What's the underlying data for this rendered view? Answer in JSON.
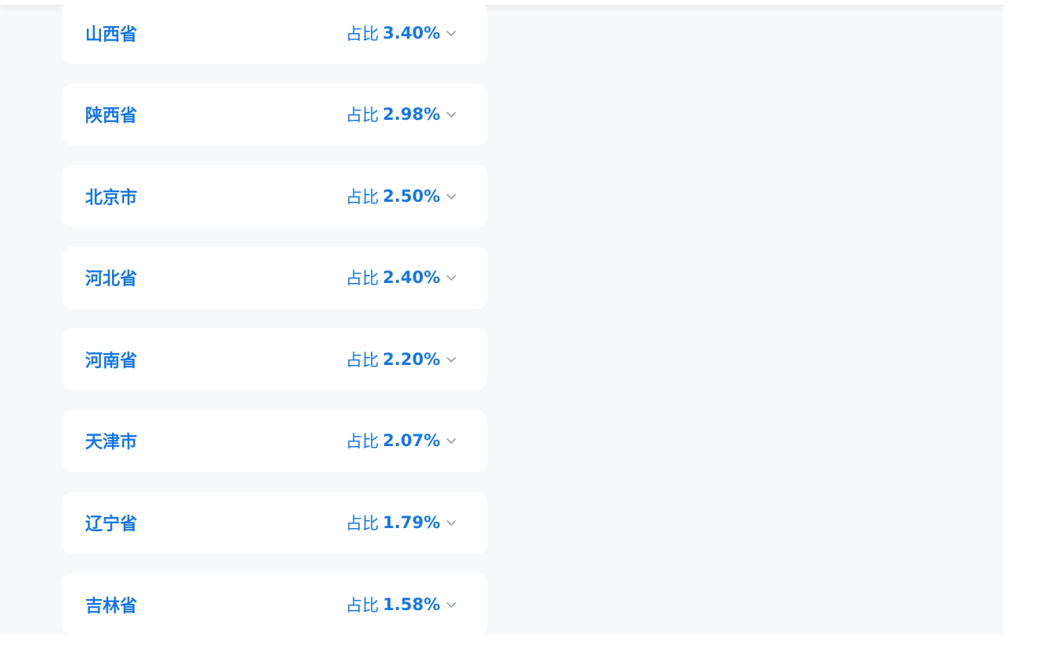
{
  "regions": [
    {
      "name": "山西省",
      "share_label": "占比",
      "share_value": "3.40%"
    },
    {
      "name": "陕西省",
      "share_label": "占比",
      "share_value": "2.98%"
    },
    {
      "name": "北京市",
      "share_label": "占比",
      "share_value": "2.50%"
    },
    {
      "name": "河北省",
      "share_label": "占比",
      "share_value": "2.40%"
    },
    {
      "name": "河南省",
      "share_label": "占比",
      "share_value": "2.20%"
    },
    {
      "name": "天津市",
      "share_label": "占比",
      "share_value": "2.07%"
    },
    {
      "name": "辽宁省",
      "share_label": "占比",
      "share_value": "1.79%"
    },
    {
      "name": "吉林省",
      "share_label": "占比",
      "share_value": "1.58%"
    }
  ],
  "colors": {
    "accent": "#1677e6",
    "card_bg": "#ffffff",
    "page_bg": "#f7f8fa",
    "chevron": "#9aa0a8"
  },
  "icons": {
    "expand": "chevron-down-icon"
  }
}
